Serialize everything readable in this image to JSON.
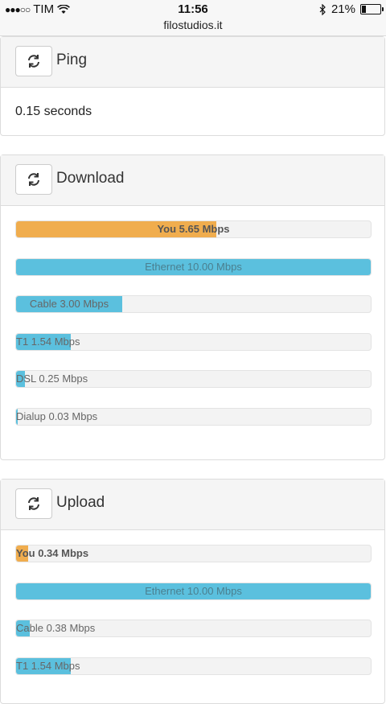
{
  "status": {
    "carrier": "TIM",
    "time": "11:56",
    "url": "filostudios.it",
    "battery": "21%",
    "battery_level": 0.21
  },
  "colors": {
    "orange": "#f0ad4e",
    "blue": "#5bc0de"
  },
  "ping": {
    "title": "Ping",
    "value": "0.15 seconds"
  },
  "download": {
    "title": "Download",
    "bars": [
      {
        "label": "You 5.65 Mbps",
        "fraction": 0.565,
        "color": "orange",
        "bold": true,
        "align": "center"
      },
      {
        "label": "Ethernet 10.00 Mbps",
        "fraction": 1.0,
        "color": "blue",
        "bold": false,
        "align": "center"
      },
      {
        "label": "Cable 3.00 Mbps",
        "fraction": 0.3,
        "color": "blue",
        "bold": false,
        "align": "center-fill"
      },
      {
        "label": "T1 1.54 Mbps",
        "fraction": 0.154,
        "color": "blue",
        "bold": false,
        "align": "left"
      },
      {
        "label": "DSL 0.25 Mbps",
        "fraction": 0.025,
        "color": "blue",
        "bold": false,
        "align": "left"
      },
      {
        "label": "Dialup 0.03 Mbps",
        "fraction": 0.003,
        "color": "blue",
        "bold": false,
        "align": "left"
      }
    ]
  },
  "upload": {
    "title": "Upload",
    "bars": [
      {
        "label": "You 0.34 Mbps",
        "fraction": 0.034,
        "color": "orange",
        "bold": true,
        "align": "left"
      },
      {
        "label": "Ethernet 10.00 Mbps",
        "fraction": 1.0,
        "color": "blue",
        "bold": false,
        "align": "center"
      },
      {
        "label": "Cable 0.38 Mbps",
        "fraction": 0.038,
        "color": "blue",
        "bold": false,
        "align": "left"
      },
      {
        "label": "T1 1.54 Mbps",
        "fraction": 0.154,
        "color": "blue",
        "bold": false,
        "align": "left"
      }
    ]
  }
}
